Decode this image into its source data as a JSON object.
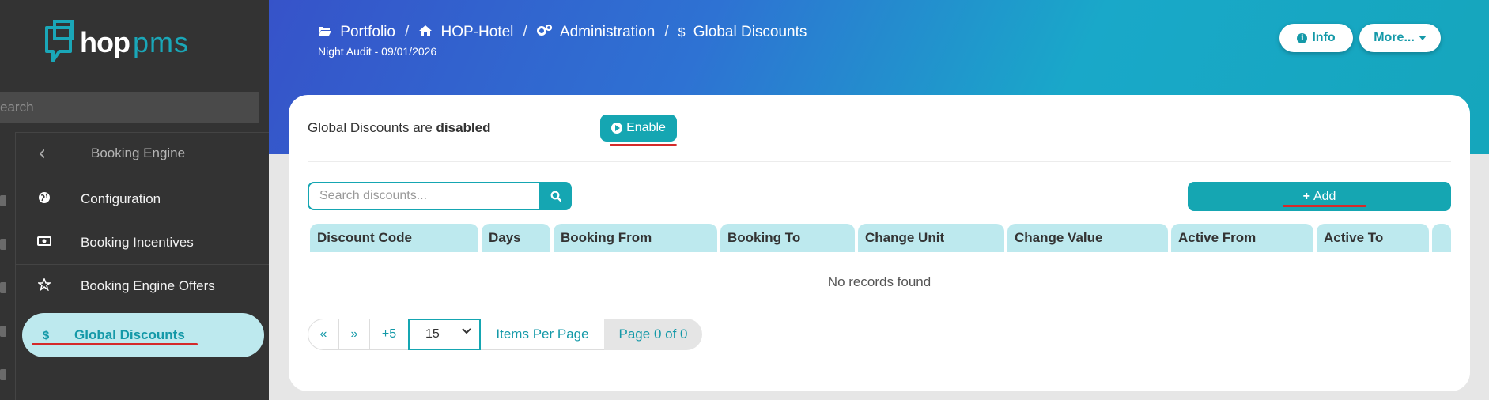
{
  "app": {
    "logo_hop": "hop",
    "logo_pms": "pms"
  },
  "sidebar": {
    "search_placeholder": "earch",
    "section_title": "Booking Engine",
    "items": [
      {
        "label": "Configuration",
        "icon": "globe-icon"
      },
      {
        "label": "Booking Incentives",
        "icon": "money-bill-icon"
      },
      {
        "label": "Booking Engine Offers",
        "icon": "star-sparkle-icon"
      },
      {
        "label": "Global Discounts",
        "icon": "dollar-icon",
        "active": true
      }
    ]
  },
  "header": {
    "breadcrumb": [
      {
        "label": "Portfolio",
        "icon": "folder-open-icon"
      },
      {
        "label": "HOP-Hotel",
        "icon": "home-icon"
      },
      {
        "label": "Administration",
        "icon": "cogs-icon"
      },
      {
        "label": "Global Discounts",
        "icon": "dollar-icon"
      }
    ],
    "separator": "/",
    "night_audit": "Night Audit - 09/01/2026",
    "info_button": "Info",
    "more_button": "More...",
    "info_icon_glyph": "i"
  },
  "status": {
    "prefix": "Global Discounts are ",
    "state": "disabled",
    "enable_button": "Enable"
  },
  "toolbar": {
    "search_placeholder": "Search discounts...",
    "add_button": "Add"
  },
  "table": {
    "columns": [
      "Discount Code",
      "Days",
      "Booking From",
      "Booking To",
      "Change Unit",
      "Change Value",
      "Active From",
      "Active To",
      ""
    ],
    "rows": [],
    "empty_message": "No records found"
  },
  "pagination": {
    "first": "«",
    "prev": "»",
    "plus_five": "+5",
    "per_page_value": "15",
    "items_per_page_label": "Items Per Page",
    "page_info": "Page 0 of 0"
  },
  "colors": {
    "accent": "#15a6b2",
    "sidebar_bg": "#333333",
    "active_bg": "#bde9ee",
    "highlight_underline": "#d42a2a"
  }
}
